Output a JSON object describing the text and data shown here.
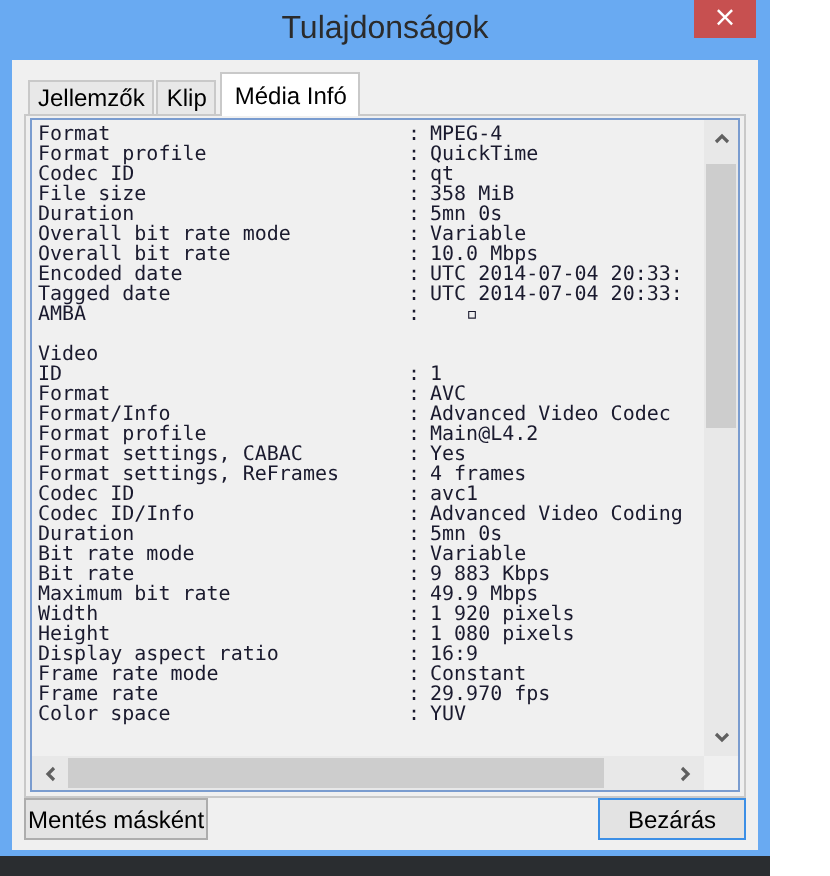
{
  "window": {
    "title": "Tulajdonságok",
    "close": "×"
  },
  "tabs": [
    {
      "label": "Jellemzők",
      "selected": false
    },
    {
      "label": "Klip",
      "selected": false
    },
    {
      "label": "Média Infó",
      "selected": true
    }
  ],
  "info": {
    "rows": [
      {
        "kind": "field",
        "label": "Format",
        "separator": ":",
        "value": "MPEG-4"
      },
      {
        "kind": "field",
        "label": "Format profile",
        "separator": ":",
        "value": "QuickTime"
      },
      {
        "kind": "field",
        "label": "Codec ID",
        "separator": ":",
        "value": "qt"
      },
      {
        "kind": "field",
        "label": "File size",
        "separator": ":",
        "value": "358 MiB"
      },
      {
        "kind": "field",
        "label": "Duration",
        "separator": ":",
        "value": "5mn 0s"
      },
      {
        "kind": "field",
        "label": "Overall bit rate mode",
        "separator": ":",
        "value": "Variable"
      },
      {
        "kind": "field",
        "label": "Overall bit rate",
        "separator": ":",
        "value": "10.0 Mbps"
      },
      {
        "kind": "field",
        "label": "Encoded date",
        "separator": ":",
        "value": "UTC 2014-07-04 20:33:"
      },
      {
        "kind": "field",
        "label": "Tagged date",
        "separator": ":",
        "value": "UTC 2014-07-04 20:33:"
      },
      {
        "kind": "field",
        "label": "AMBA",
        "separator": ":",
        "value": "   ▫"
      },
      {
        "kind": "blank"
      },
      {
        "kind": "section",
        "label": "Video"
      },
      {
        "kind": "field",
        "label": "ID",
        "separator": ":",
        "value": "1"
      },
      {
        "kind": "field",
        "label": "Format",
        "separator": ":",
        "value": "AVC"
      },
      {
        "kind": "field",
        "label": "Format/Info",
        "separator": ":",
        "value": "Advanced Video Codec"
      },
      {
        "kind": "field",
        "label": "Format profile",
        "separator": ":",
        "value": "Main@L4.2"
      },
      {
        "kind": "field",
        "label": "Format settings, CABAC",
        "separator": ":",
        "value": "Yes"
      },
      {
        "kind": "field",
        "label": "Format settings, ReFrames",
        "separator": ":",
        "value": "4 frames"
      },
      {
        "kind": "field",
        "label": "Codec ID",
        "separator": ":",
        "value": "avc1"
      },
      {
        "kind": "field",
        "label": "Codec ID/Info",
        "separator": ":",
        "value": "Advanced Video Coding"
      },
      {
        "kind": "field",
        "label": "Duration",
        "separator": ":",
        "value": "5mn 0s"
      },
      {
        "kind": "field",
        "label": "Bit rate mode",
        "separator": ":",
        "value": "Variable"
      },
      {
        "kind": "field",
        "label": "Bit rate",
        "separator": ":",
        "value": "9 883 Kbps"
      },
      {
        "kind": "field",
        "label": "Maximum bit rate",
        "separator": ":",
        "value": "49.9 Mbps"
      },
      {
        "kind": "field",
        "label": "Width",
        "separator": ":",
        "value": "1 920 pixels"
      },
      {
        "kind": "field",
        "label": "Height",
        "separator": ":",
        "value": "1 080 pixels"
      },
      {
        "kind": "field",
        "label": "Display aspect ratio",
        "separator": ":",
        "value": "16:9"
      },
      {
        "kind": "field",
        "label": "Frame rate mode",
        "separator": ":",
        "value": "Constant"
      },
      {
        "kind": "field",
        "label": "Frame rate",
        "separator": ":",
        "value": "29.970 fps"
      },
      {
        "kind": "field",
        "label": "Color space",
        "separator": ":",
        "value": "YUV"
      }
    ]
  },
  "buttons": [
    {
      "label": "Mentés másként",
      "default": false
    },
    {
      "label": "Bezárás",
      "default": true
    }
  ]
}
